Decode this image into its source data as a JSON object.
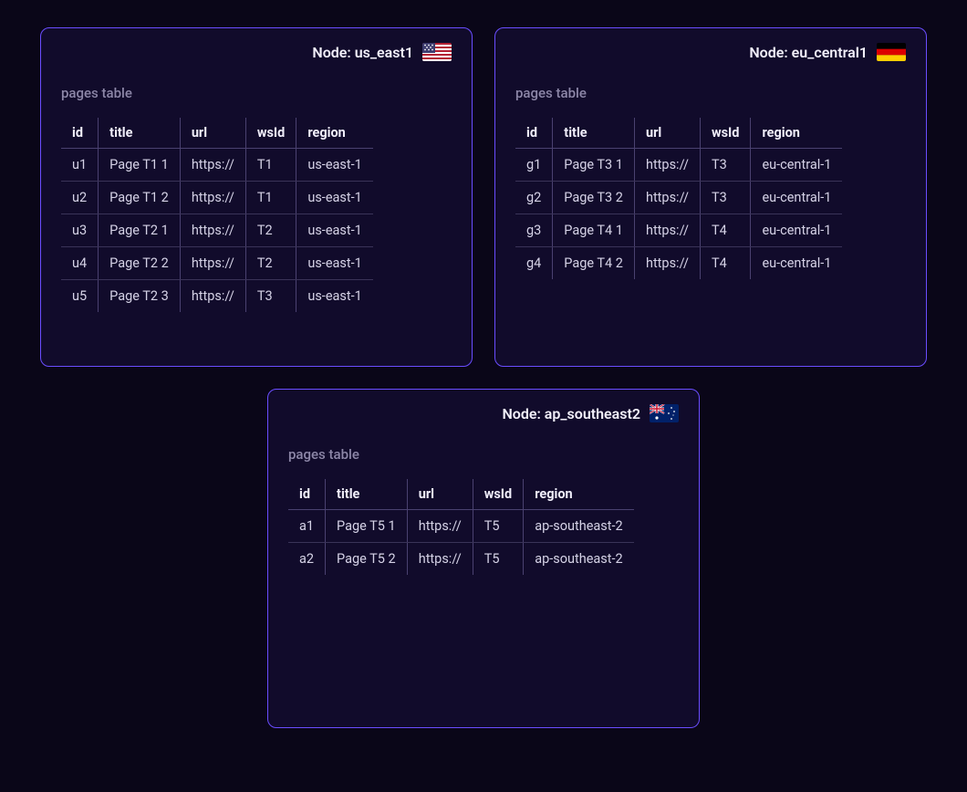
{
  "nodes": [
    {
      "id": "us_east1",
      "title_prefix": "Node: ",
      "title": "us_east1",
      "flag": "us",
      "table_title": "pages table",
      "columns": [
        "id",
        "title",
        "url",
        "wsId",
        "region"
      ],
      "rows": [
        [
          "u1",
          "Page T1 1",
          "https://",
          "T1",
          "us-east-1"
        ],
        [
          "u2",
          "Page T1 2",
          "https://",
          "T1",
          "us-east-1"
        ],
        [
          "u3",
          "Page T2 1",
          "https://",
          "T2",
          "us-east-1"
        ],
        [
          "u4",
          "Page T2 2",
          "https://",
          "T2",
          "us-east-1"
        ],
        [
          "u5",
          "Page T2 3",
          "https://",
          "T3",
          "us-east-1"
        ]
      ]
    },
    {
      "id": "eu_central1",
      "title_prefix": "Node: ",
      "title": "eu_central1",
      "flag": "de",
      "table_title": "pages table",
      "columns": [
        "id",
        "title",
        "url",
        "wsId",
        "region"
      ],
      "rows": [
        [
          "g1",
          "Page T3 1",
          "https://",
          "T3",
          "eu-central-1"
        ],
        [
          "g2",
          "Page T3 2",
          "https://",
          "T3",
          "eu-central-1"
        ],
        [
          "g3",
          "Page T4 1",
          "https://",
          "T4",
          "eu-central-1"
        ],
        [
          "g4",
          "Page T4 2",
          "https://",
          "T4",
          "eu-central-1"
        ]
      ]
    },
    {
      "id": "ap_southeast2",
      "title_prefix": "Node: ",
      "title": "ap_southeast2",
      "flag": "au",
      "table_title": "pages table",
      "columns": [
        "id",
        "title",
        "url",
        "wsId",
        "region"
      ],
      "rows": [
        [
          "a1",
          "Page T5 1",
          "https://",
          "T5",
          "ap-southeast-2"
        ],
        [
          "a2",
          "Page T5 2",
          "https://",
          "T5",
          "ap-southeast-2"
        ]
      ]
    }
  ]
}
